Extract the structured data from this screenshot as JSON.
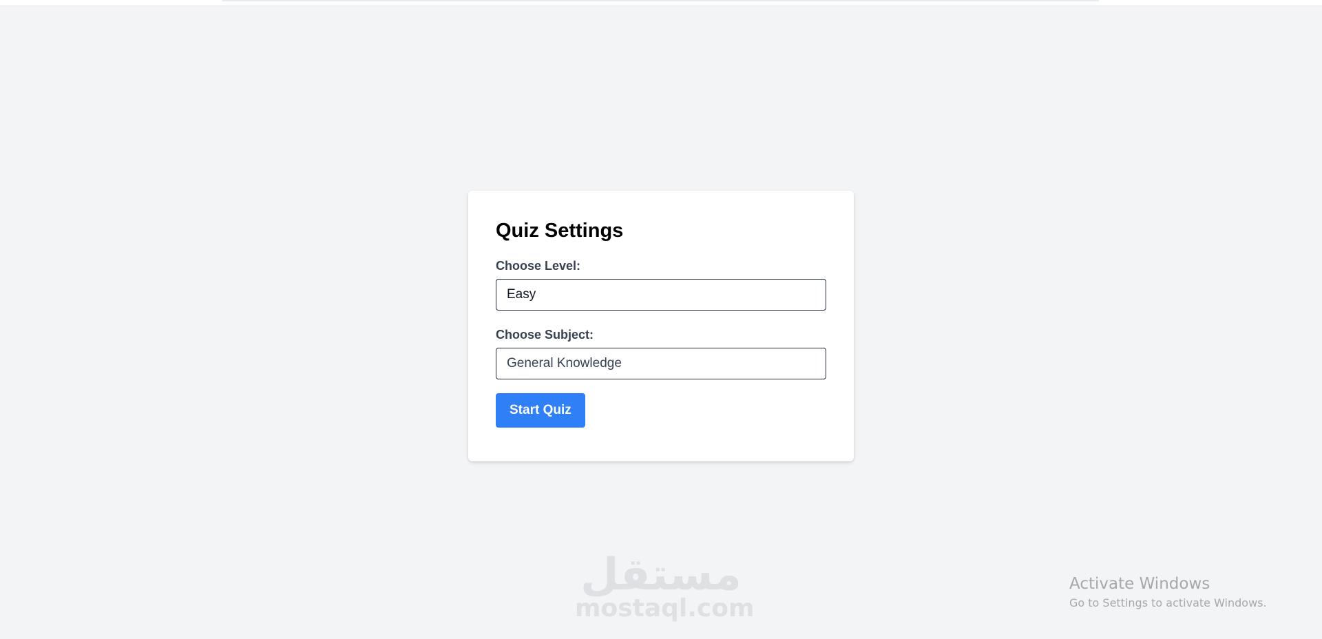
{
  "quiz": {
    "title": "Quiz Settings",
    "level_label": "Choose Level:",
    "level_value": "Easy",
    "subject_label": "Choose Subject:",
    "subject_value": "General Knowledge",
    "start_button": "Start Quiz"
  },
  "colors": {
    "page_background": "#f3f4f6",
    "card_background": "#ffffff",
    "button": "#2f80f7",
    "button_text": "#ffffff"
  },
  "watermark": {
    "arabic": "مستقل",
    "latin": "mostaql.com"
  },
  "windows_notice": {
    "title": "Activate Windows",
    "subtitle": "Go to Settings to activate Windows."
  }
}
